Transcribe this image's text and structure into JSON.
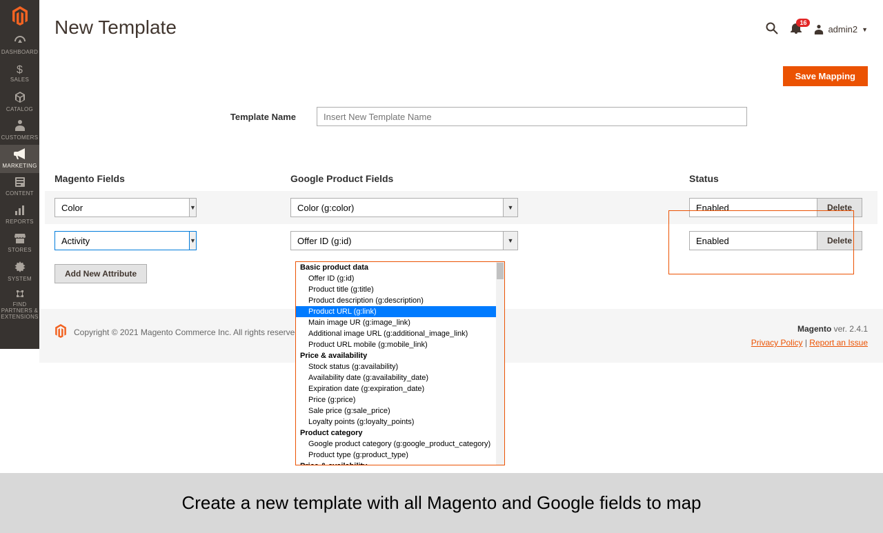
{
  "sidebar": {
    "items": [
      {
        "label": "DASHBOARD"
      },
      {
        "label": "SALES"
      },
      {
        "label": "CATALOG"
      },
      {
        "label": "CUSTOMERS"
      },
      {
        "label": "MARKETING"
      },
      {
        "label": "CONTENT"
      },
      {
        "label": "REPORTS"
      },
      {
        "label": "STORES"
      },
      {
        "label": "SYSTEM"
      },
      {
        "label": "FIND PARTNERS & EXTENSIONS"
      }
    ]
  },
  "header": {
    "title": "New Template",
    "notif_count": "16",
    "admin_user": "admin2"
  },
  "actions": {
    "save_label": "Save Mapping"
  },
  "template_field": {
    "label": "Template Name",
    "placeholder": "Insert New Template Name"
  },
  "columns": {
    "magento": "Magento Fields",
    "google": "Google Product Fields",
    "status": "Status"
  },
  "rows": [
    {
      "magento": "Color",
      "google": "Color (g:color)",
      "status": "Enabled",
      "delete": "Delete"
    },
    {
      "magento": "Activity",
      "google": "Offer ID (g:id)",
      "status": "Enabled",
      "delete": "Delete"
    }
  ],
  "add_button": "Add New Attribute",
  "dropdown": {
    "groups": [
      {
        "label": "Basic product data",
        "items": [
          "Offer ID (g:id)",
          "Product title (g:title)",
          "Product description (g:description)",
          "Product URL (g:link)",
          "Main image UR (g:image_link)",
          "Additional image URL (g:additional_image_link)",
          "Product URL mobile (g:mobile_link)"
        ],
        "selected_index": 3
      },
      {
        "label": "Price & availability",
        "items": [
          "Stock status (g:availability)",
          "Availability date (g:availability_date)",
          "Expiration date (g:expiration_date)",
          "Price (g:price)",
          "Sale price (g:sale_price)",
          "Loyalty points (g:loyalty_points)"
        ]
      },
      {
        "label": "Product category",
        "items": [
          "Google product category (g:google_product_category)",
          "Product type (g:product_type)"
        ]
      },
      {
        "label": "Price & availability",
        "items": []
      }
    ]
  },
  "footer": {
    "copyright": "Copyright © 2021 Magento Commerce Inc. All rights reserved.",
    "version_label": "Magento",
    "version": " ver. 2.4.1",
    "privacy": "Privacy Policy",
    "report": "Report an Issue"
  },
  "caption": "Create a new template with all Magento and Google fields to map"
}
